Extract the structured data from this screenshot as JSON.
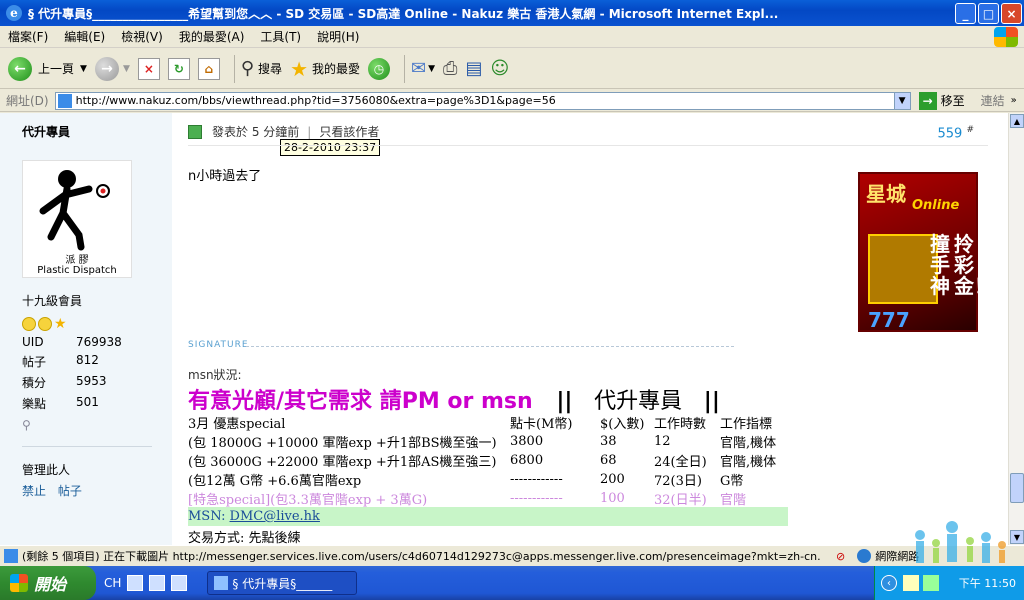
{
  "window": {
    "title": "§ 代升專員§________________希望幫到您︿︿ - SD 交易區 - SD高達 Online - Nakuz 樂古 香港人氣網 - Microsoft Internet Expl...",
    "min_label": "_",
    "max_label": "□",
    "close_label": "×"
  },
  "menu": [
    "檔案(F)",
    "編輯(E)",
    "檢視(V)",
    "我的最愛(A)",
    "工具(T)",
    "說明(H)"
  ],
  "toolbar": {
    "back_label": "上一頁",
    "search_label": "搜尋",
    "favorites_label": "我的最愛"
  },
  "address": {
    "label": "網址(D)",
    "url": "http://www.nakuz.com/bbs/viewthread.php?tid=3756080&extra=page%3D1&page=56",
    "go_label": "移至",
    "links_label": "連結"
  },
  "sidebar": {
    "username": "代升專員",
    "avatar_caption1": "派 膠",
    "avatar_caption2": "Plastic Dispatch",
    "rank": "十九級會員",
    "stats": [
      {
        "key": "UID",
        "value": "769938"
      },
      {
        "key": "帖子",
        "value": "812"
      },
      {
        "key": "積分",
        "value": "5953"
      },
      {
        "key": "樂點",
        "value": "501"
      }
    ],
    "manage_label": "管理此人",
    "ban_label": "禁止",
    "posts_label": "帖子"
  },
  "post": {
    "posted": "發表於 5 分鐘前",
    "author_only": "只看該作者",
    "tooltip": "28-2-2010 23:37",
    "number": "559",
    "number_suffix": "#",
    "message": "n小時過去了",
    "ad_title": "星城",
    "ad_sub": "Online",
    "ad_v1": "拎彩金！",
    "ad_v2": "撞手神",
    "ad_sevens": "777",
    "signature_label": "SIGNATURE",
    "msn_status": "msn狀況:",
    "headline": "有意光顧/其它需求 請PM or msn",
    "bars1": "||",
    "headline_title": "代升專員",
    "bars2": "||",
    "table_rows": [
      [
        "3月 優惠special",
        "點卡(M幣)",
        "$(入數)",
        "工作時數",
        "工作指標"
      ],
      [
        "(包 18000G +10000 軍階exp +升1部BS機至強一)",
        "3800",
        "38",
        "12",
        "官階,機体"
      ],
      [
        "(包 36000G +22000 軍階exp +升1部AS機至強三)",
        "6800",
        "68",
        "24(全日)",
        "官階,機体"
      ],
      [
        "(包12萬 G幣  +6.6萬官階exp",
        "------------",
        "200",
        "72(3日)",
        "G幣"
      ],
      [
        "[特急special](包3.3萬官階exp + 3萬G)",
        "------------",
        "100",
        "32(日半)",
        "官階"
      ]
    ],
    "msn_prefix": "MSN:",
    "msn_email": "DMC@live.hk",
    "trade": "交易方式: 先點後練"
  },
  "status": {
    "text": "(剩餘 5 個項目) 正在下載圖片 http://messenger.services.live.com/users/c4d60714d129273c@apps.messenger.live.com/presenceimage?mkt=zh-cn.",
    "zone": "網際網路"
  },
  "taskbar": {
    "start": "開始",
    "lang": "CH",
    "task_label": "§ 代升專員§______",
    "clock": "下午 11:50"
  }
}
